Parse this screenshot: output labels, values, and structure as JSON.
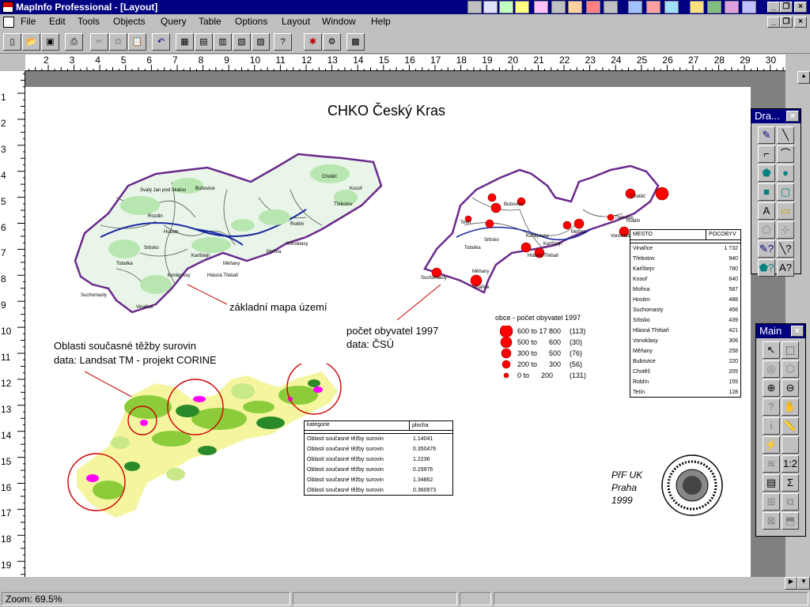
{
  "window": {
    "title": "MapInfo Professional - [Layout]"
  },
  "menu": [
    "File",
    "Edit",
    "Tools",
    "Objects",
    "Query",
    "Table",
    "Options",
    "Layout",
    "Window",
    "Help"
  ],
  "ruler": {
    "h": [
      "2",
      "3",
      "4",
      "5",
      "6",
      "7",
      "8",
      "9",
      "10",
      "11",
      "12",
      "13",
      "14",
      "15",
      "16",
      "17",
      "18",
      "19",
      "20",
      "21",
      "22",
      "23",
      "24",
      "25",
      "26",
      "27",
      "28",
      "29",
      "30"
    ],
    "v": [
      "1",
      "2",
      "3",
      "4",
      "5",
      "6",
      "7",
      "8",
      "9",
      "10",
      "11",
      "12",
      "13",
      "14",
      "15",
      "16",
      "17",
      "18",
      "19"
    ]
  },
  "layout": {
    "title": "CHKO Český Kras",
    "label_base": "základní mapa území",
    "label_pop_1": "počet obyvatel 1997",
    "label_pop_2": "data: ČSÚ",
    "label_mining_1": "Oblasti současné těžby surovin",
    "label_mining_2": "data:  Landsat TM - projekt CORINE",
    "signature_1": "PřF UK",
    "signature_2": "Praha",
    "signature_3": "1999",
    "base_map_towns": [
      "Svatý Jan pod Skalou",
      "Bubovice",
      "Rozdin",
      "Srbsko",
      "Karlštejn",
      "Mořina",
      "Tobolka",
      "Koněprusy",
      "Vinařice",
      "Suchomasty",
      "Hlásná Třebaň",
      "Vonoklasy",
      "Roblín",
      "Chotěč",
      "Kosoř",
      "Třebotov",
      "Hostim",
      "Měňany"
    ],
    "pop_map_towns": [
      "Bubovice",
      "Tetín",
      "Roblín",
      "Chotěč",
      "Srbsko",
      "Mořina",
      "Vonoklasy",
      "Koněprusy",
      "Karlštejn",
      "Tobolka",
      "Hlásná Třebaň",
      "Měňany",
      "Suchomasty",
      "Vinařice",
      "Třebotov"
    ]
  },
  "legend": {
    "title": "obce - počet obyvatel 1997",
    "rows": [
      {
        "range": "600 to 17 800",
        "count": "(113)"
      },
      {
        "range": "500 to      600",
        "count": "(30)"
      },
      {
        "range": "300 to      500",
        "count": "(76)"
      },
      {
        "range": "200 to      300",
        "count": "(56)"
      },
      {
        "range": "0 to      200",
        "count": "(131)"
      }
    ]
  },
  "population_table": {
    "headers": [
      "MESTO",
      "POCOBYV"
    ],
    "rows": [
      [
        "Vinařice",
        "1 732"
      ],
      [
        "Třebotov",
        "940"
      ],
      [
        "Karlštejn",
        "780"
      ],
      [
        "Kosoř",
        "640"
      ],
      [
        "Mořina",
        "587"
      ],
      [
        "Hostim",
        "488"
      ],
      [
        "Suchomasty",
        "456"
      ],
      [
        "Srbsko",
        "439"
      ],
      [
        "Hlásná Třebaň",
        "421"
      ],
      [
        "Vonoklasy",
        "306"
      ],
      [
        "Měňany",
        "258"
      ],
      [
        "Bubovice",
        "220"
      ],
      [
        "Chotěč",
        "205"
      ],
      [
        "Roblín",
        "155"
      ],
      [
        "Tetín",
        "128"
      ]
    ]
  },
  "mining_table": {
    "headers": [
      "kategorie",
      "plocha"
    ],
    "rows": [
      [
        "Oblasti současné těžby surovin",
        "1.14041"
      ],
      [
        "Oblasti současné těžby surovin",
        "0.350476"
      ],
      [
        "Oblasti současné těžby surovin",
        "1.2236"
      ],
      [
        "Oblasti současné těžby surovin",
        "0.29976"
      ],
      [
        "Oblasti současné těžby surovin",
        "1.34862"
      ],
      [
        "Oblasti současné těžby surovin",
        "0.360973"
      ]
    ]
  },
  "draw_palette": {
    "title": "Dra..."
  },
  "main_palette": {
    "title": "Main"
  },
  "status": {
    "zoom": "Zoom: 69.5%"
  },
  "colors": {
    "titlebar": "#000080",
    "region": "#6a2a8a",
    "dot": "#ff0000",
    "mining": "#ff00ff"
  }
}
